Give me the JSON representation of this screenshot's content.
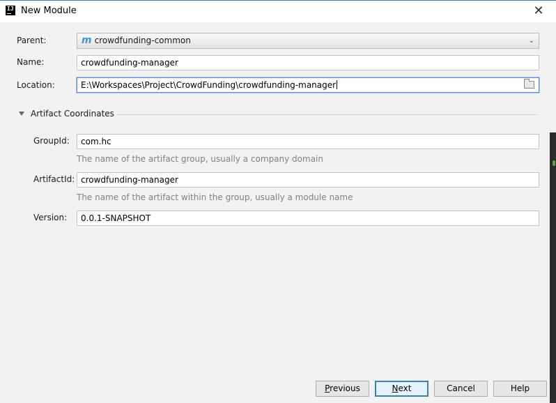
{
  "window": {
    "title": "New Module",
    "close_label": "✕"
  },
  "form": {
    "parent_label": "Parent:",
    "parent_value": "crowdfunding-common",
    "parent_icon_glyph": "m",
    "name_label": "Name:",
    "name_value": "crowdfunding-manager",
    "location_label": "Location:",
    "location_value": "E:\\Workspaces\\Project\\CrowdFunding\\crowdfunding-manager"
  },
  "artifact": {
    "section_title": "Artifact Coordinates",
    "groupid_label": "GroupId:",
    "groupid_value": "com.hc",
    "groupid_hint": "The name of the artifact group, usually a company domain",
    "artifactid_label": "ArtifactId:",
    "artifactid_value": "crowdfunding-manager",
    "artifactid_hint": "The name of the artifact within the group, usually a module name",
    "version_label": "Version:",
    "version_value": "0.0.1-SNAPSHOT"
  },
  "buttons": {
    "previous_mnemonic": "P",
    "previous_rest": "revious",
    "next_mnemonic": "N",
    "next_rest": "ext",
    "cancel": "Cancel",
    "help": "Help"
  },
  "colors": {
    "accent": "#3c7fb1",
    "maven_icon": "#3f93d6",
    "hint_text": "#808080"
  }
}
